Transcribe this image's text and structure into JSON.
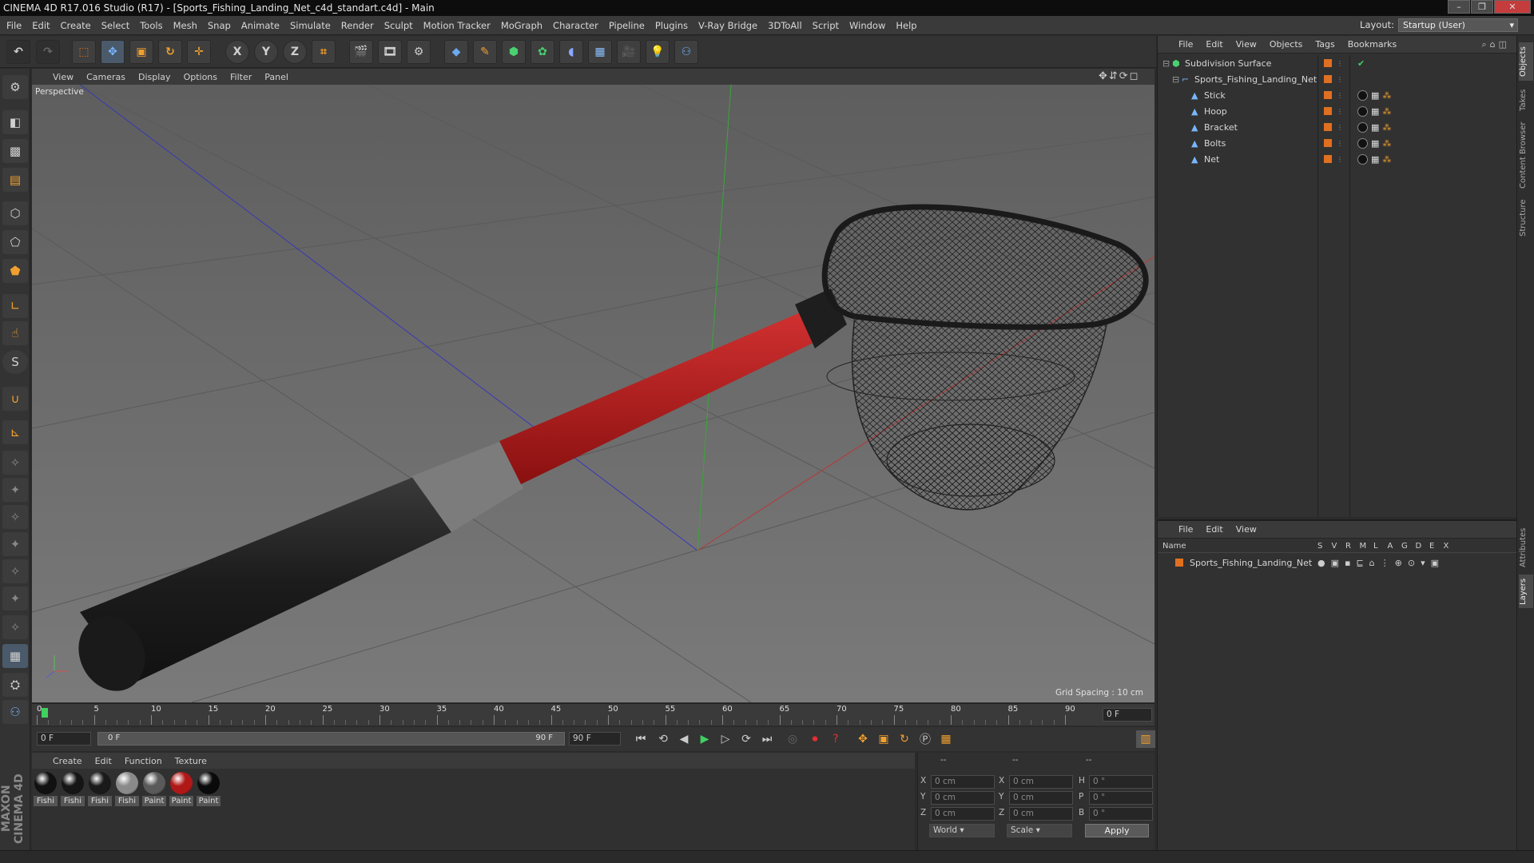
{
  "title": "CINEMA 4D R17.016 Studio (R17) - [Sports_Fishing_Landing_Net_c4d_standart.c4d] - Main",
  "menu": [
    "File",
    "Edit",
    "Create",
    "Select",
    "Tools",
    "Mesh",
    "Snap",
    "Animate",
    "Simulate",
    "Render",
    "Sculpt",
    "Motion Tracker",
    "MoGraph",
    "Character",
    "Pipeline",
    "Plugins",
    "V-Ray Bridge",
    "3DToAll",
    "Script",
    "Window",
    "Help"
  ],
  "layout": {
    "label": "Layout:",
    "value": "Startup (User)"
  },
  "toolbar": {
    "x": "X",
    "y": "Y",
    "z": "Z"
  },
  "viewport": {
    "menu": [
      "View",
      "Cameras",
      "Display",
      "Options",
      "Filter",
      "Panel"
    ],
    "label": "Perspective",
    "grid_spacing": "Grid Spacing : 10 cm"
  },
  "timeline": {
    "ticks": [
      "0",
      "5",
      "10",
      "15",
      "20",
      "25",
      "30",
      "35",
      "40",
      "45",
      "50",
      "55",
      "60",
      "65",
      "70",
      "75",
      "80",
      "85",
      "90"
    ],
    "frame_end_field": "0 F"
  },
  "controls": {
    "current_frame": "0 F",
    "range_start": "0 F",
    "range_end": "90 F",
    "max_frame": "90 F"
  },
  "materials": {
    "menu": [
      "Create",
      "Edit",
      "Function",
      "Texture"
    ],
    "items": [
      {
        "label": "Fishi",
        "color": "#111111"
      },
      {
        "label": "Fishi",
        "color": "#151515"
      },
      {
        "label": "Fishi",
        "color": "#1a1a1a"
      },
      {
        "label": "Fishi",
        "color": "#8a8a8a"
      },
      {
        "label": "Paint",
        "color": "#5a5a5a"
      },
      {
        "label": "Paint",
        "color": "#b01818"
      },
      {
        "label": "Paint",
        "color": "#0a0a0a"
      }
    ]
  },
  "coords": {
    "headers": [
      "--",
      "--",
      "--"
    ],
    "rows": [
      {
        "a": "X",
        "av": "0 cm",
        "b": "X",
        "bv": "0 cm",
        "c": "H",
        "cv": "0 °"
      },
      {
        "a": "Y",
        "av": "0 cm",
        "b": "Y",
        "bv": "0 cm",
        "c": "P",
        "cv": "0 °"
      },
      {
        "a": "Z",
        "av": "0 cm",
        "b": "Z",
        "bv": "0 cm",
        "c": "B",
        "cv": "0 °"
      }
    ],
    "world": "World",
    "scale": "Scale",
    "apply": "Apply"
  },
  "objects": {
    "menu": [
      "File",
      "Edit",
      "View",
      "Objects",
      "Tags",
      "Bookmarks"
    ],
    "items": [
      {
        "name": "Subdivision Surface",
        "indent": 0
      },
      {
        "name": "Sports_Fishing_Landing_Net",
        "indent": 1
      },
      {
        "name": "Stick",
        "indent": 2
      },
      {
        "name": "Hoop",
        "indent": 2
      },
      {
        "name": "Bracket",
        "indent": 2
      },
      {
        "name": "Bolts",
        "indent": 2
      },
      {
        "name": "Net",
        "indent": 2
      }
    ]
  },
  "layers": {
    "menu": [
      "File",
      "Edit",
      "View"
    ],
    "columns": [
      "Name",
      "S",
      "V",
      "R",
      "M",
      "L",
      "A",
      "G",
      "D",
      "E",
      "X"
    ],
    "items": [
      {
        "name": "Sports_Fishing_Landing_Net",
        "color": "#e07020"
      }
    ]
  },
  "side_tabs": [
    "Objects",
    "Takes",
    "Content Browser",
    "Structure",
    "Attributes",
    "Layers"
  ],
  "brand": "MAXON CINEMA 4D",
  "colors": {
    "accent_orange": "#e07020",
    "handle_red": "#b01c1c",
    "viewport_bg": "#6c6c6c"
  }
}
